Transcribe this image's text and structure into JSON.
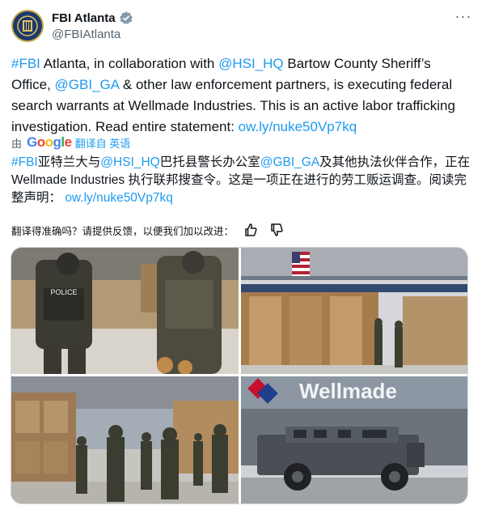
{
  "account": {
    "display_name": "FBI Atlanta",
    "handle": "@FBIAtlanta",
    "verified_icon": "verified-badge-icon",
    "more_icon": "more-options-icon"
  },
  "tweet": {
    "segments": [
      {
        "text": "#FBI",
        "link": true
      },
      {
        "text": " Atlanta, in collaboration with ",
        "link": false
      },
      {
        "text": "@HSI_HQ",
        "link": true
      },
      {
        "text": "  Bartow County Sheriff’s Office, ",
        "link": false
      },
      {
        "text": "@GBI_GA",
        "link": true
      },
      {
        "text": " & other law enforcement partners, is executing federal search warrants at Wellmade Industries. This is an active labor trafficking investigation. Read entire statement:  ",
        "link": false
      },
      {
        "text": "ow.ly/nuke50Vp7kq",
        "link": true
      }
    ]
  },
  "translation": {
    "by_label": "由",
    "provider": "Google",
    "from_label": "翻译自 英语",
    "segments": [
      {
        "text": "#FBI",
        "link": true
      },
      {
        "text": "亚特兰大与",
        "link": false
      },
      {
        "text": "@HSI_HQ",
        "link": true
      },
      {
        "text": "巴托县警长办公室",
        "link": false
      },
      {
        "text": "@GBI_GA",
        "link": true
      },
      {
        "text": "及其他执法伙伴合作，正在 Wellmade Industries 执行联邦搜查令。这是一项正在进行的劳工贩运调查。阅读完整声明：  ",
        "link": false
      },
      {
        "text": "ow.ly/nuke50Vp7kq",
        "link": true
      }
    ],
    "feedback_prompt": "翻译得准确吗？请提供反馈，以便我们加以改进：",
    "thumbs_up_icon": "thumbs-up-icon",
    "thumbs_down_icon": "thumbs-down-icon"
  },
  "media": {
    "photos": [
      {
        "name": "agents-in-warehouse-photo",
        "vest_text": "POLICE"
      },
      {
        "name": "warehouse-pallets-flag-photo"
      },
      {
        "name": "tactical-team-walking-photo"
      },
      {
        "name": "armored-vehicle-wellmade-photo",
        "sign_text": "Wellmade"
      }
    ]
  },
  "colors": {
    "link": "#1d9bf0",
    "text": "#0f1419",
    "secondary": "#536471",
    "border": "#cfd9de"
  }
}
